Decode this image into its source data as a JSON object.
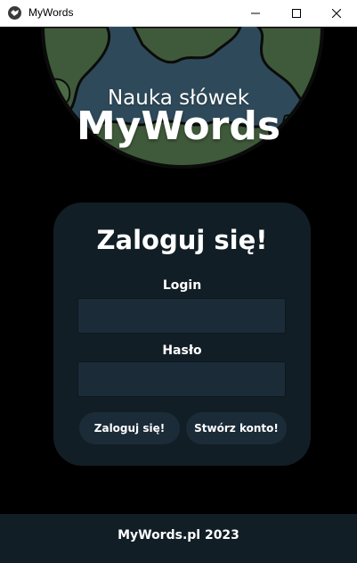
{
  "window": {
    "title": "MyWords",
    "icon": "app-logo-icon",
    "controls": [
      "minimize-icon",
      "maximize-icon",
      "close-icon"
    ]
  },
  "header": {
    "subtitle": "Nauka słówek",
    "title": "MyWords"
  },
  "login_card": {
    "title": "Zaloguj się!",
    "login_label": "Login",
    "login_value": "",
    "password_label": "Hasło",
    "password_value": "",
    "login_button": "Zaloguj się!",
    "register_button": "Stwórz konto!"
  },
  "footer": {
    "text": "MyWords.pl 2023"
  },
  "colors": {
    "background": "#000000",
    "card": "#121e26",
    "input": "#1b2b38",
    "globe_land": "#3f5a3a",
    "globe_water": "#2e4a5a"
  }
}
